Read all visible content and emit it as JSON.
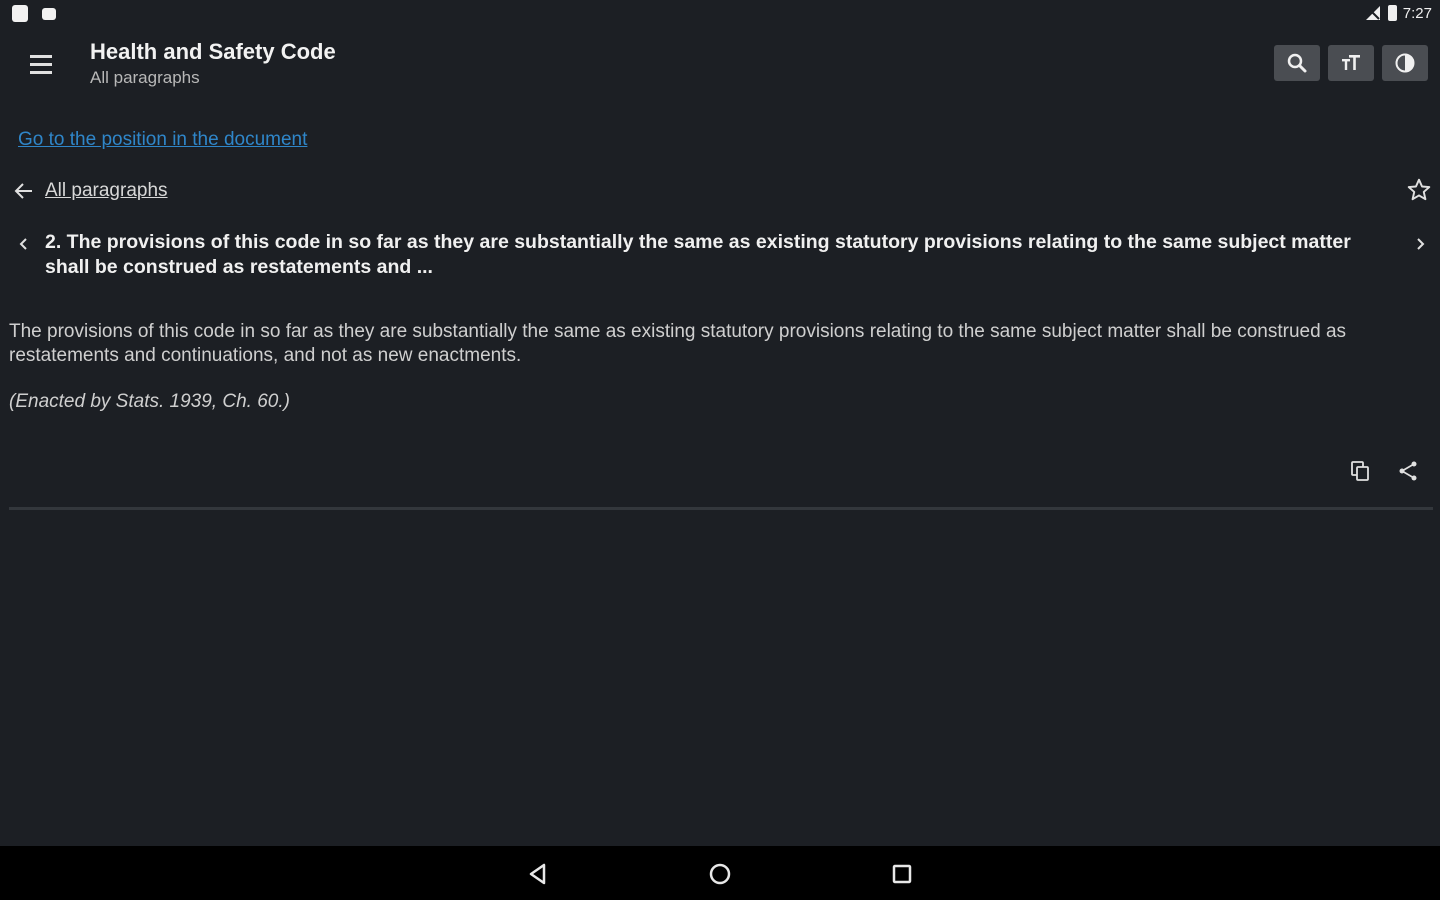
{
  "status_bar": {
    "time": "7:27",
    "icons": [
      "notification-icon",
      "notification-icon",
      "signal-icon",
      "battery-icon"
    ]
  },
  "app_bar": {
    "title": "Health and Safety Code",
    "subtitle": "All paragraphs",
    "menu_icon": "hamburger-menu-icon",
    "actions": [
      {
        "name": "search",
        "icon": "search-icon"
      },
      {
        "name": "text-size",
        "icon": "text-size-icon"
      },
      {
        "name": "contrast",
        "icon": "contrast-icon"
      }
    ]
  },
  "content": {
    "goto_link": "Go to the position in the document",
    "breadcrumb": "All paragraphs",
    "paragraph_heading": "2. The provisions of this code in so far as they are substantially the same as existing statutory provisions relating to the same subject matter shall be construed as restatements and ...",
    "paragraph_body": "The provisions of this code in so far as they are substantially the same as existing statutory provisions relating to the same subject matter shall be construed as restatements and continuations, and not as new enactments.",
    "enacted_note": "(Enacted by Stats. 1939, Ch. 60.)"
  },
  "colors": {
    "background": "#1c1f24",
    "link": "#2f86c9",
    "toolbar_button": "#4a4d52",
    "nav_bar": "#000000"
  }
}
